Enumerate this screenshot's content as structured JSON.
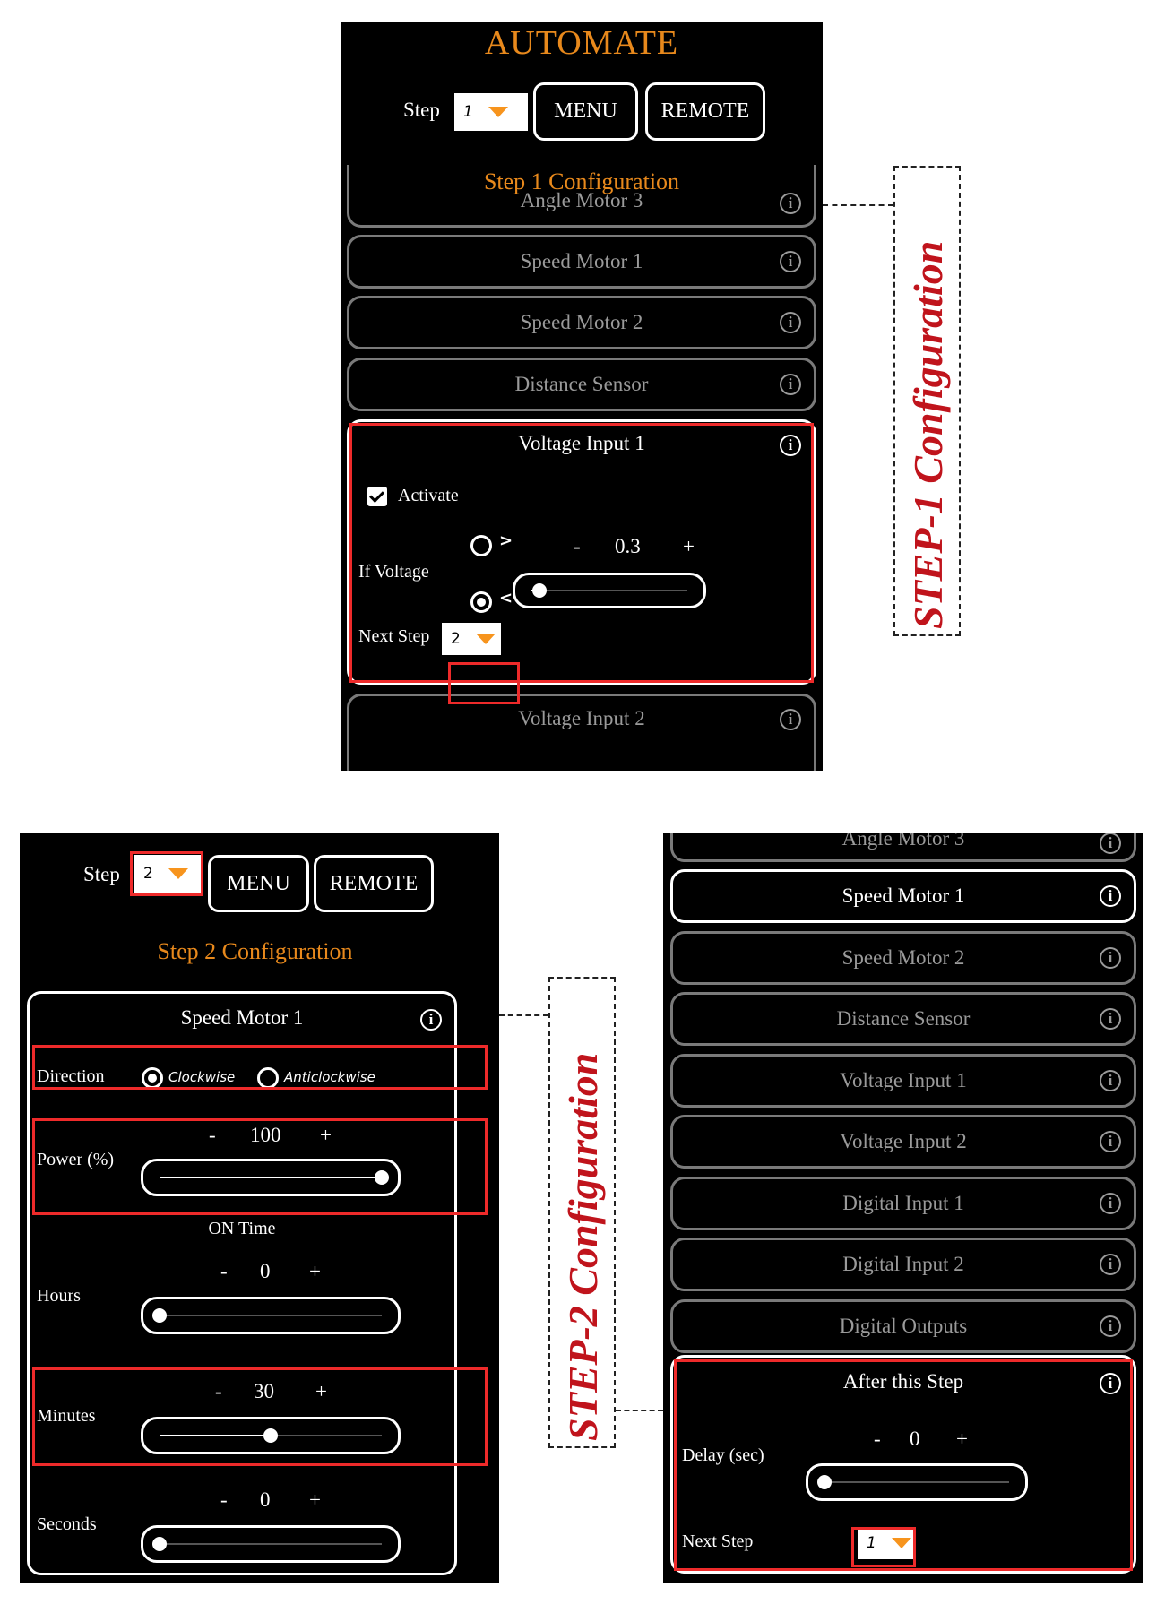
{
  "colors": {
    "accent_orange": "#e8891c",
    "dropdown_arrow": "#f7941d",
    "highlight_red": "#ee2a2a",
    "callout_red": "#c0141c",
    "panel_bg": "#000000",
    "inactive_item": "#9a9a9a"
  },
  "top_panel": {
    "app_title": "AUTOMATE",
    "step_label": "Step",
    "step_value": "1",
    "menu_button": "MENU",
    "remote_button": "REMOTE",
    "config_title": "Step 1 Configuration",
    "items": [
      {
        "label": "Angle Motor 3",
        "icon": "info-icon"
      },
      {
        "label": "Speed Motor 1",
        "icon": "info-icon"
      },
      {
        "label": "Speed Motor 2",
        "icon": "info-icon"
      },
      {
        "label": "Distance Sensor",
        "icon": "info-icon"
      }
    ],
    "voltage_input_1": {
      "title": "Voltage Input 1",
      "activate_label": "Activate",
      "activate_checked": true,
      "if_voltage_label": "If Voltage",
      "greater_symbol": ">",
      "less_symbol": "<",
      "comparison_selected": "<",
      "minus": "-",
      "plus": "+",
      "value": "0.3",
      "slider_fraction": 0.05,
      "next_step_label": "Next Step",
      "next_step_value": "2"
    },
    "trailing_item": {
      "label": "Voltage Input 2",
      "icon": "info-icon"
    }
  },
  "left_panel": {
    "step_label": "Step",
    "step_value": "2",
    "menu_button": "MENU",
    "remote_button": "REMOTE",
    "config_title": "Step 2 Configuration",
    "speed_motor_1": {
      "title": "Speed Motor 1",
      "direction_label": "Direction",
      "direction_options": [
        "Clockwise",
        "Anticlockwise"
      ],
      "direction_selected": "Clockwise",
      "power_label": "Power (%)",
      "power_value": "100",
      "power_fraction": 1.0,
      "on_time_label": "ON Time",
      "hours_label": "Hours",
      "hours_value": "0",
      "hours_fraction": 0.0,
      "minutes_label": "Minutes",
      "minutes_value": "30",
      "minutes_fraction": 0.5,
      "seconds_label": "Seconds",
      "seconds_value": "0",
      "seconds_fraction": 0.0,
      "minus": "-",
      "plus": "+"
    }
  },
  "right_panel": {
    "clipped_item": "Angle Motor 3",
    "items": [
      {
        "label": "Speed Motor 1",
        "active": true
      },
      {
        "label": "Speed Motor 2",
        "active": false
      },
      {
        "label": "Distance Sensor",
        "active": false
      },
      {
        "label": "Voltage Input 1",
        "active": false
      },
      {
        "label": "Voltage Input 2",
        "active": false
      },
      {
        "label": "Digital Input 1",
        "active": false
      },
      {
        "label": "Digital Input 2",
        "active": false
      },
      {
        "label": "Digital Outputs",
        "active": false
      }
    ],
    "after_step": {
      "title": "After this Step",
      "delay_label": "Delay (sec)",
      "delay_value": "0",
      "delay_fraction": 0.0,
      "minus": "-",
      "plus": "+",
      "next_step_label": "Next Step",
      "next_step_value": "1"
    }
  },
  "callouts": {
    "step1": "STEP-1 Configuration",
    "step2": "STEP-2 Configuration"
  },
  "info_glyph": "i"
}
